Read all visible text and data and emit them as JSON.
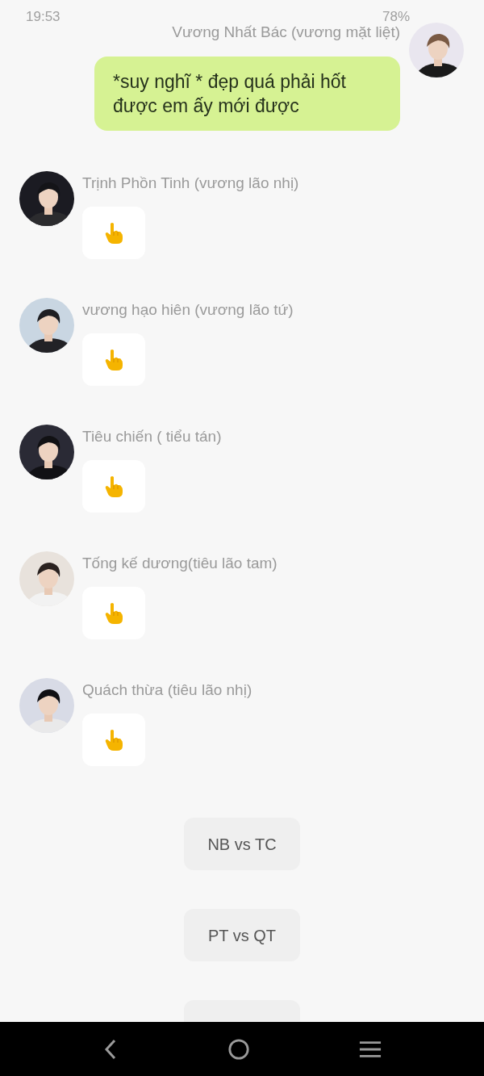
{
  "status_bar": {
    "time": "19:53",
    "battery": "78%"
  },
  "messages": [
    {
      "kind": "sent",
      "sender": "Vương Nhất Bác (vương mặt liệt)",
      "text": "*suy nghĩ * đẹp quá phải hốt được em ấy mới được"
    },
    {
      "kind": "received",
      "sender": "Trịnh Phồn Tinh (vương lão nhị)",
      "sticker": true
    },
    {
      "kind": "received",
      "sender": "vương hạo hiên (vương lão tứ)",
      "sticker": true
    },
    {
      "kind": "received",
      "sender": "Tiêu chiến ( tiểu tán)",
      "sticker": true
    },
    {
      "kind": "received",
      "sender": "Tống kế dương(tiêu lão tam)",
      "sticker": true
    },
    {
      "kind": "received",
      "sender": "Quách thừa (tiêu lão nhị)",
      "sticker": true
    }
  ],
  "notices": [
    {
      "kind": "text",
      "text": "NB vs TC"
    },
    {
      "kind": "text",
      "text": "PT vs QT"
    },
    {
      "kind": "clipped"
    }
  ]
}
